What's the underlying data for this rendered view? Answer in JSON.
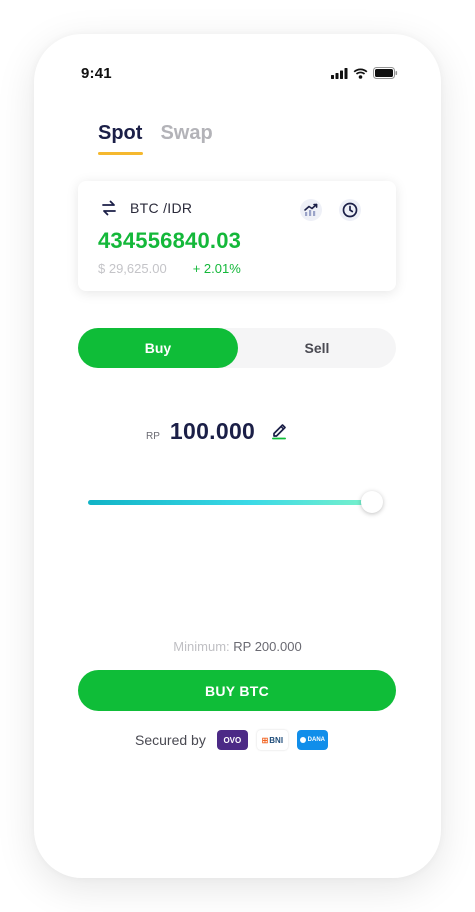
{
  "status_bar": {
    "time": "9:41"
  },
  "tabs": [
    {
      "label": "Spot",
      "active": true
    },
    {
      "label": "Swap",
      "active": false
    }
  ],
  "ticker": {
    "pair": "BTC /IDR",
    "price": "434556840.03",
    "usd_price": "$ 29,625.00",
    "change": "+ 2.01%",
    "icons": {
      "swap": "swap-arrows-icon",
      "chart": "trend-chart-icon",
      "history": "clock-icon"
    }
  },
  "trade_toggle": {
    "buy_label": "Buy",
    "sell_label": "Sell",
    "selected": "Buy"
  },
  "amount": {
    "currency": "RP",
    "value": "100.000",
    "edit_icon": "pencil-icon"
  },
  "slider": {
    "level": 1.0
  },
  "minimum": {
    "label": "Minimum:",
    "value": "RP 200.000"
  },
  "buy_button": {
    "label": "BUY BTC"
  },
  "secured": {
    "label": "Secured by",
    "partners": [
      {
        "name": "OVO"
      },
      {
        "name": "BNI"
      },
      {
        "name": "DANA"
      }
    ]
  },
  "colors": {
    "accent_green": "#0fbd38",
    "tab_underline": "#f5b82e",
    "title_navy": "#1b1f47",
    "slider_start": "#11b3c6",
    "slider_end": "#7ff3c8"
  }
}
